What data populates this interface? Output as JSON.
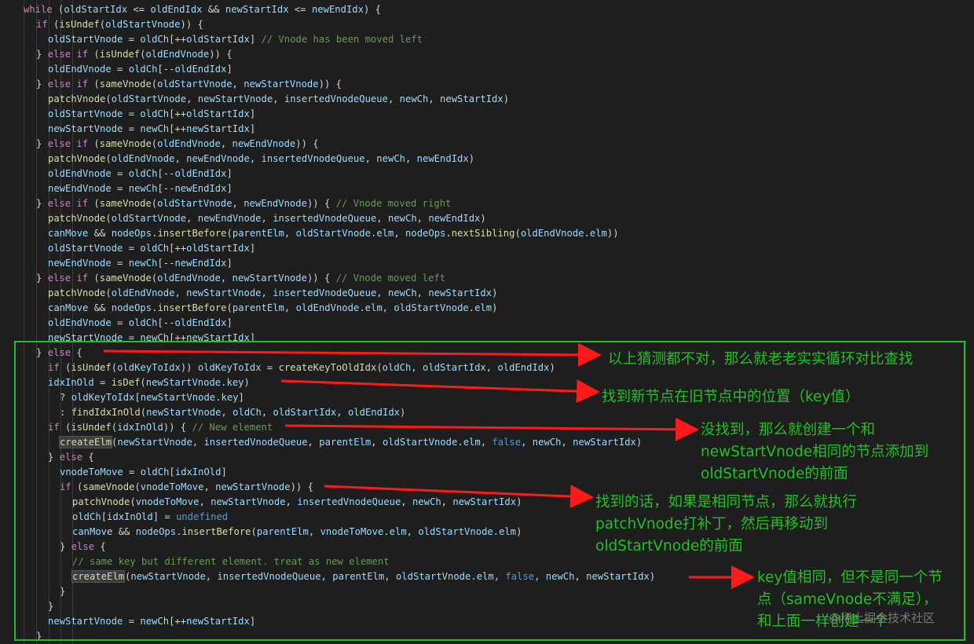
{
  "code_lines": [
    [
      [
        "kw",
        "while"
      ],
      [
        "pn",
        " ("
      ],
      [
        "var",
        "oldStartIdx"
      ],
      [
        "pn",
        " <= "
      ],
      [
        "var",
        "oldEndIdx"
      ],
      [
        "pn",
        " && "
      ],
      [
        "var",
        "newStartIdx"
      ],
      [
        "pn",
        " <= "
      ],
      [
        "var",
        "newEndIdx"
      ],
      [
        "pn",
        ") {"
      ]
    ],
    [
      [
        "kw",
        "if"
      ],
      [
        "pn",
        " ("
      ],
      [
        "fn",
        "isUndef"
      ],
      [
        "pn",
        "("
      ],
      [
        "var",
        "oldStartVnode"
      ],
      [
        "pn",
        ")) {"
      ]
    ],
    [
      [
        "var",
        "oldStartVnode"
      ],
      [
        "pn",
        " = "
      ],
      [
        "var",
        "oldCh"
      ],
      [
        "pn",
        "[++"
      ],
      [
        "var",
        "oldStartIdx"
      ],
      [
        "pn",
        "] "
      ],
      [
        "cm",
        "// Vnode has been moved left"
      ]
    ],
    [
      [
        "pn",
        "} "
      ],
      [
        "kw",
        "else if"
      ],
      [
        "pn",
        " ("
      ],
      [
        "fn",
        "isUndef"
      ],
      [
        "pn",
        "("
      ],
      [
        "var",
        "oldEndVnode"
      ],
      [
        "pn",
        ")) {"
      ]
    ],
    [
      [
        "var",
        "oldEndVnode"
      ],
      [
        "pn",
        " = "
      ],
      [
        "var",
        "oldCh"
      ],
      [
        "pn",
        "[--"
      ],
      [
        "var",
        "oldEndIdx"
      ],
      [
        "pn",
        "]"
      ]
    ],
    [
      [
        "pn",
        "} "
      ],
      [
        "kw",
        "else if"
      ],
      [
        "pn",
        " ("
      ],
      [
        "fn",
        "sameVnode"
      ],
      [
        "pn",
        "("
      ],
      [
        "var",
        "oldStartVnode"
      ],
      [
        "pn",
        ", "
      ],
      [
        "var",
        "newStartVnode"
      ],
      [
        "pn",
        ")) {"
      ]
    ],
    [
      [
        "fn",
        "patchVnode"
      ],
      [
        "pn",
        "("
      ],
      [
        "var",
        "oldStartVnode"
      ],
      [
        "pn",
        ", "
      ],
      [
        "var",
        "newStartVnode"
      ],
      [
        "pn",
        ", "
      ],
      [
        "var",
        "insertedVnodeQueue"
      ],
      [
        "pn",
        ", "
      ],
      [
        "var",
        "newCh"
      ],
      [
        "pn",
        ", "
      ],
      [
        "var",
        "newStartIdx"
      ],
      [
        "pn",
        ")"
      ]
    ],
    [
      [
        "var",
        "oldStartVnode"
      ],
      [
        "pn",
        " = "
      ],
      [
        "var",
        "oldCh"
      ],
      [
        "pn",
        "[++"
      ],
      [
        "var",
        "oldStartIdx"
      ],
      [
        "pn",
        "]"
      ]
    ],
    [
      [
        "var",
        "newStartVnode"
      ],
      [
        "pn",
        " = "
      ],
      [
        "var",
        "newCh"
      ],
      [
        "pn",
        "[++"
      ],
      [
        "var",
        "newStartIdx"
      ],
      [
        "pn",
        "]"
      ]
    ],
    [
      [
        "pn",
        "} "
      ],
      [
        "kw",
        "else if"
      ],
      [
        "pn",
        " ("
      ],
      [
        "fn",
        "sameVnode"
      ],
      [
        "pn",
        "("
      ],
      [
        "var",
        "oldEndVnode"
      ],
      [
        "pn",
        ", "
      ],
      [
        "var",
        "newEndVnode"
      ],
      [
        "pn",
        ")) {"
      ]
    ],
    [
      [
        "fn",
        "patchVnode"
      ],
      [
        "pn",
        "("
      ],
      [
        "var",
        "oldEndVnode"
      ],
      [
        "pn",
        ", "
      ],
      [
        "var",
        "newEndVnode"
      ],
      [
        "pn",
        ", "
      ],
      [
        "var",
        "insertedVnodeQueue"
      ],
      [
        "pn",
        ", "
      ],
      [
        "var",
        "newCh"
      ],
      [
        "pn",
        ", "
      ],
      [
        "var",
        "newEndIdx"
      ],
      [
        "pn",
        ")"
      ]
    ],
    [
      [
        "var",
        "oldEndVnode"
      ],
      [
        "pn",
        " = "
      ],
      [
        "var",
        "oldCh"
      ],
      [
        "pn",
        "[--"
      ],
      [
        "var",
        "oldEndIdx"
      ],
      [
        "pn",
        "]"
      ]
    ],
    [
      [
        "var",
        "newEndVnode"
      ],
      [
        "pn",
        " = "
      ],
      [
        "var",
        "newCh"
      ],
      [
        "pn",
        "[--"
      ],
      [
        "var",
        "newEndIdx"
      ],
      [
        "pn",
        "]"
      ]
    ],
    [
      [
        "pn",
        "} "
      ],
      [
        "kw",
        "else if"
      ],
      [
        "pn",
        " ("
      ],
      [
        "fn",
        "sameVnode"
      ],
      [
        "pn",
        "("
      ],
      [
        "var",
        "oldStartVnode"
      ],
      [
        "pn",
        ", "
      ],
      [
        "var",
        "newEndVnode"
      ],
      [
        "pn",
        ")) { "
      ],
      [
        "cm",
        "// Vnode moved right"
      ]
    ],
    [
      [
        "fn",
        "patchVnode"
      ],
      [
        "pn",
        "("
      ],
      [
        "var",
        "oldStartVnode"
      ],
      [
        "pn",
        ", "
      ],
      [
        "var",
        "newEndVnode"
      ],
      [
        "pn",
        ", "
      ],
      [
        "var",
        "insertedVnodeQueue"
      ],
      [
        "pn",
        ", "
      ],
      [
        "var",
        "newCh"
      ],
      [
        "pn",
        ", "
      ],
      [
        "var",
        "newEndIdx"
      ],
      [
        "pn",
        ")"
      ]
    ],
    [
      [
        "var",
        "canMove"
      ],
      [
        "pn",
        " && "
      ],
      [
        "var",
        "nodeOps"
      ],
      [
        "pn",
        "."
      ],
      [
        "fn",
        "insertBefore"
      ],
      [
        "pn",
        "("
      ],
      [
        "var",
        "parentElm"
      ],
      [
        "pn",
        ", "
      ],
      [
        "var",
        "oldStartVnode"
      ],
      [
        "pn",
        "."
      ],
      [
        "var",
        "elm"
      ],
      [
        "pn",
        ", "
      ],
      [
        "var",
        "nodeOps"
      ],
      [
        "pn",
        "."
      ],
      [
        "fn",
        "nextSibling"
      ],
      [
        "pn",
        "("
      ],
      [
        "var",
        "oldEndVnode"
      ],
      [
        "pn",
        "."
      ],
      [
        "var",
        "elm"
      ],
      [
        "pn",
        "))"
      ]
    ],
    [
      [
        "var",
        "oldStartVnode"
      ],
      [
        "pn",
        " = "
      ],
      [
        "var",
        "oldCh"
      ],
      [
        "pn",
        "[++"
      ],
      [
        "var",
        "oldStartIdx"
      ],
      [
        "pn",
        "]"
      ]
    ],
    [
      [
        "var",
        "newEndVnode"
      ],
      [
        "pn",
        " = "
      ],
      [
        "var",
        "newCh"
      ],
      [
        "pn",
        "[--"
      ],
      [
        "var",
        "newEndIdx"
      ],
      [
        "pn",
        "]"
      ]
    ],
    [
      [
        "pn",
        "} "
      ],
      [
        "kw",
        "else if"
      ],
      [
        "pn",
        " ("
      ],
      [
        "fn",
        "sameVnode"
      ],
      [
        "pn",
        "("
      ],
      [
        "var",
        "oldEndVnode"
      ],
      [
        "pn",
        ", "
      ],
      [
        "var",
        "newStartVnode"
      ],
      [
        "pn",
        ")) { "
      ],
      [
        "cm",
        "// Vnode moved left"
      ]
    ],
    [
      [
        "fn",
        "patchVnode"
      ],
      [
        "pn",
        "("
      ],
      [
        "var",
        "oldEndVnode"
      ],
      [
        "pn",
        ", "
      ],
      [
        "var",
        "newStartVnode"
      ],
      [
        "pn",
        ", "
      ],
      [
        "var",
        "insertedVnodeQueue"
      ],
      [
        "pn",
        ", "
      ],
      [
        "var",
        "newCh"
      ],
      [
        "pn",
        ", "
      ],
      [
        "var",
        "newStartIdx"
      ],
      [
        "pn",
        ")"
      ]
    ],
    [
      [
        "var",
        "canMove"
      ],
      [
        "pn",
        " && "
      ],
      [
        "var",
        "nodeOps"
      ],
      [
        "pn",
        "."
      ],
      [
        "fn",
        "insertBefore"
      ],
      [
        "pn",
        "("
      ],
      [
        "var",
        "parentElm"
      ],
      [
        "pn",
        ", "
      ],
      [
        "var",
        "oldEndVnode"
      ],
      [
        "pn",
        "."
      ],
      [
        "var",
        "elm"
      ],
      [
        "pn",
        ", "
      ],
      [
        "var",
        "oldStartVnode"
      ],
      [
        "pn",
        "."
      ],
      [
        "var",
        "elm"
      ],
      [
        "pn",
        ")"
      ]
    ],
    [
      [
        "var",
        "oldEndVnode"
      ],
      [
        "pn",
        " = "
      ],
      [
        "var",
        "oldCh"
      ],
      [
        "pn",
        "[--"
      ],
      [
        "var",
        "oldEndIdx"
      ],
      [
        "pn",
        "]"
      ]
    ],
    [
      [
        "var",
        "newStartVnode"
      ],
      [
        "pn",
        " = "
      ],
      [
        "var",
        "newCh"
      ],
      [
        "pn",
        "[++"
      ],
      [
        "var",
        "newStartIdx"
      ],
      [
        "pn",
        "]"
      ]
    ],
    [
      [
        "pn",
        "} "
      ],
      [
        "kw",
        "else"
      ],
      [
        "pn",
        " {"
      ]
    ],
    [
      [
        "kw",
        "if"
      ],
      [
        "pn",
        " ("
      ],
      [
        "fn",
        "isUndef"
      ],
      [
        "pn",
        "("
      ],
      [
        "var",
        "oldKeyToIdx"
      ],
      [
        "pn",
        ")) "
      ],
      [
        "var",
        "oldKeyToIdx"
      ],
      [
        "pn",
        " = "
      ],
      [
        "fn",
        "createKeyToOldIdx"
      ],
      [
        "pn",
        "("
      ],
      [
        "var",
        "oldCh"
      ],
      [
        "pn",
        ", "
      ],
      [
        "var",
        "oldStartIdx"
      ],
      [
        "pn",
        ", "
      ],
      [
        "var",
        "oldEndIdx"
      ],
      [
        "pn",
        ")"
      ]
    ],
    [
      [
        "var",
        "idxInOld"
      ],
      [
        "pn",
        " = "
      ],
      [
        "fn",
        "isDef"
      ],
      [
        "pn",
        "("
      ],
      [
        "var",
        "newStartVnode"
      ],
      [
        "pn",
        "."
      ],
      [
        "var",
        "key"
      ],
      [
        "pn",
        ")"
      ]
    ],
    [
      [
        "pn",
        "? "
      ],
      [
        "var",
        "oldKeyToIdx"
      ],
      [
        "pn",
        "["
      ],
      [
        "var",
        "newStartVnode"
      ],
      [
        "pn",
        "."
      ],
      [
        "var",
        "key"
      ],
      [
        "pn",
        "]"
      ]
    ],
    [
      [
        "pn",
        ": "
      ],
      [
        "fn",
        "findIdxInOld"
      ],
      [
        "pn",
        "("
      ],
      [
        "var",
        "newStartVnode"
      ],
      [
        "pn",
        ", "
      ],
      [
        "var",
        "oldCh"
      ],
      [
        "pn",
        ", "
      ],
      [
        "var",
        "oldStartIdx"
      ],
      [
        "pn",
        ", "
      ],
      [
        "var",
        "oldEndIdx"
      ],
      [
        "pn",
        ")"
      ]
    ],
    [
      [
        "kw",
        "if"
      ],
      [
        "pn",
        " ("
      ],
      [
        "fn",
        "isUndef"
      ],
      [
        "pn",
        "("
      ],
      [
        "var",
        "idxInOld"
      ],
      [
        "pn",
        ")) { "
      ],
      [
        "cm",
        "// New element"
      ]
    ],
    [
      [
        "fn",
        "createElm"
      ],
      [
        "pn",
        "("
      ],
      [
        "var",
        "newStartVnode"
      ],
      [
        "pn",
        ", "
      ],
      [
        "var",
        "insertedVnodeQueue"
      ],
      [
        "pn",
        ", "
      ],
      [
        "var",
        "parentElm"
      ],
      [
        "pn",
        ", "
      ],
      [
        "var",
        "oldStartVnode"
      ],
      [
        "pn",
        "."
      ],
      [
        "var",
        "elm"
      ],
      [
        "pn",
        ", "
      ],
      [
        "kc",
        "false"
      ],
      [
        "pn",
        ", "
      ],
      [
        "var",
        "newCh"
      ],
      [
        "pn",
        ", "
      ],
      [
        "var",
        "newStartIdx"
      ],
      [
        "pn",
        ")"
      ]
    ],
    [
      [
        "pn",
        "} "
      ],
      [
        "kw",
        "else"
      ],
      [
        "pn",
        " {"
      ]
    ],
    [
      [
        "var",
        "vnodeToMove"
      ],
      [
        "pn",
        " = "
      ],
      [
        "var",
        "oldCh"
      ],
      [
        "pn",
        "["
      ],
      [
        "var",
        "idxInOld"
      ],
      [
        "pn",
        "]"
      ]
    ],
    [
      [
        "kw",
        "if"
      ],
      [
        "pn",
        " ("
      ],
      [
        "fn",
        "sameVnode"
      ],
      [
        "pn",
        "("
      ],
      [
        "var",
        "vnodeToMove"
      ],
      [
        "pn",
        ", "
      ],
      [
        "var",
        "newStartVnode"
      ],
      [
        "pn",
        ")) {"
      ]
    ],
    [
      [
        "fn",
        "patchVnode"
      ],
      [
        "pn",
        "("
      ],
      [
        "var",
        "vnodeToMove"
      ],
      [
        "pn",
        ", "
      ],
      [
        "var",
        "newStartVnode"
      ],
      [
        "pn",
        ", "
      ],
      [
        "var",
        "insertedVnodeQueue"
      ],
      [
        "pn",
        ", "
      ],
      [
        "var",
        "newCh"
      ],
      [
        "pn",
        ", "
      ],
      [
        "var",
        "newStartIdx"
      ],
      [
        "pn",
        ")"
      ]
    ],
    [
      [
        "var",
        "oldCh"
      ],
      [
        "pn",
        "["
      ],
      [
        "var",
        "idxInOld"
      ],
      [
        "pn",
        "] = "
      ],
      [
        "kc",
        "undefined"
      ]
    ],
    [
      [
        "var",
        "canMove"
      ],
      [
        "pn",
        " && "
      ],
      [
        "var",
        "nodeOps"
      ],
      [
        "pn",
        "."
      ],
      [
        "fn",
        "insertBefore"
      ],
      [
        "pn",
        "("
      ],
      [
        "var",
        "parentElm"
      ],
      [
        "pn",
        ", "
      ],
      [
        "var",
        "vnodeToMove"
      ],
      [
        "pn",
        "."
      ],
      [
        "var",
        "elm"
      ],
      [
        "pn",
        ", "
      ],
      [
        "var",
        "oldStartVnode"
      ],
      [
        "pn",
        "."
      ],
      [
        "var",
        "elm"
      ],
      [
        "pn",
        ")"
      ]
    ],
    [
      [
        "pn",
        "} "
      ],
      [
        "kw",
        "else"
      ],
      [
        "pn",
        " {"
      ]
    ],
    [
      [
        "cm",
        "// same key but different element. treat as new element"
      ]
    ],
    [
      [
        "fn",
        "createElm"
      ],
      [
        "pn",
        "("
      ],
      [
        "var",
        "newStartVnode"
      ],
      [
        "pn",
        ", "
      ],
      [
        "var",
        "insertedVnodeQueue"
      ],
      [
        "pn",
        ", "
      ],
      [
        "var",
        "parentElm"
      ],
      [
        "pn",
        ", "
      ],
      [
        "var",
        "oldStartVnode"
      ],
      [
        "pn",
        "."
      ],
      [
        "var",
        "elm"
      ],
      [
        "pn",
        ", "
      ],
      [
        "kc",
        "false"
      ],
      [
        "pn",
        ", "
      ],
      [
        "var",
        "newCh"
      ],
      [
        "pn",
        ", "
      ],
      [
        "var",
        "newStartIdx"
      ],
      [
        "pn",
        ")"
      ]
    ],
    [
      [
        "pn",
        "}"
      ]
    ],
    [
      [
        "pn",
        "}"
      ]
    ],
    [
      [
        "var",
        "newStartVnode"
      ],
      [
        "pn",
        " = "
      ],
      [
        "var",
        "newCh"
      ],
      [
        "pn",
        "[++"
      ],
      [
        "var",
        "newStartIdx"
      ],
      [
        "pn",
        "]"
      ]
    ],
    [
      [
        "pn",
        "}"
      ]
    ]
  ],
  "annotations": {
    "note_1": "以上猜测都不对，那么就老老实实循环对比查找",
    "note_2": "找到新节点在旧节点中的位置（key值）",
    "note_3": "没找到，那么就创建一个和\nnewStartVnode相同的节点添加到\noldStartVnode的前面",
    "note_4": "找到的话，如果是相同节点，那么就执行\npatchVnode打补丁，然后再移动到\noldStartVnode的前面",
    "note_5": "key值相同，但不是同一个节\n点（sameVnode不满足），\n和上面一样创建一个"
  },
  "watermark": "@稀土掘金技术社区",
  "colors": {
    "background": "#1e1e1e",
    "keyword": "#c586c0",
    "function": "#dcdcaa",
    "variable": "#9cdcfe",
    "comment": "#6a9955",
    "constant": "#569cd6",
    "annotation": "#22c122",
    "arrow": "#ff1a1a"
  }
}
